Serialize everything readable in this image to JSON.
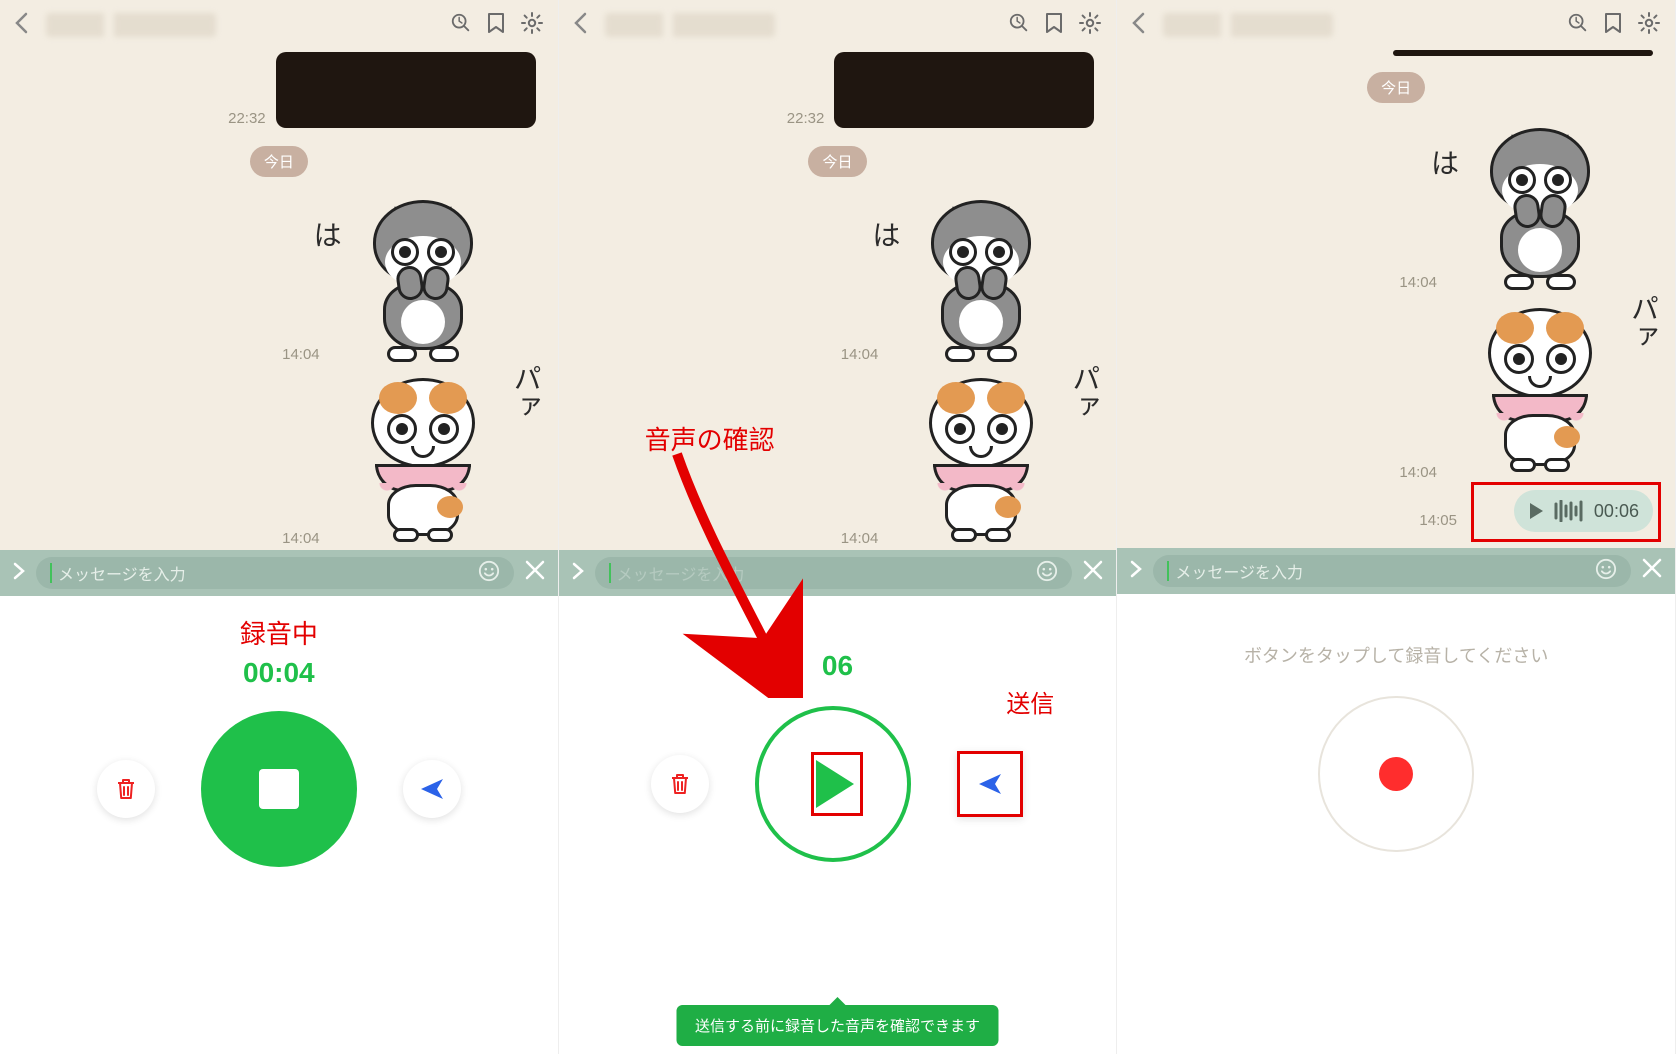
{
  "header": {
    "icons": {
      "search": "search",
      "bookmark": "bookmark",
      "settings": "settings"
    }
  },
  "chat": {
    "day_badge": "今日",
    "ts_dark": "22:32",
    "ts_sticker1": "14:04",
    "ts_sticker2": "14:04",
    "ts_voice": "14:05",
    "sticker1_text": "は",
    "sticker2_text": "パァ",
    "voice_duration": "00:06"
  },
  "inputbar": {
    "placeholder": "メッセージを入力"
  },
  "panel1": {
    "label": "録音中",
    "time": "00:04"
  },
  "panel2": {
    "anno_confirm": "音声の確認",
    "anno_send": "送信",
    "time_partial": "06",
    "banner": "送信する前に録音した音声を確認できます"
  },
  "panel3": {
    "hint": "ボタンをタップして録音してください"
  }
}
